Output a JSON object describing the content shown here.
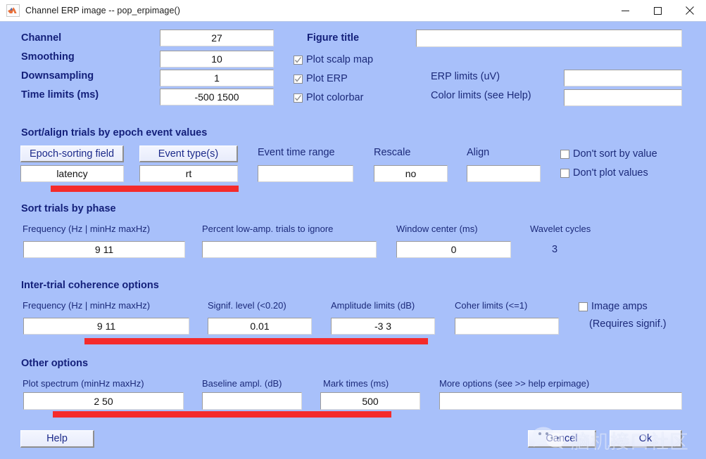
{
  "window": {
    "title": "Channel ERP image -- pop_erpimage()",
    "icon": "matlab-icon",
    "controls": {
      "minimize": "minimize-icon",
      "maximize": "maximize-icon",
      "close": "close-icon"
    }
  },
  "colors": {
    "background": "#a8c0fa",
    "label_text": "#1c2a7a",
    "field_background": "#ffffff",
    "highlight_bar": "#f42b2b"
  },
  "top_section": {
    "labels": {
      "channel": "Channel",
      "smoothing": "Smoothing",
      "downsampling": "Downsampling",
      "time_limits": "Time limits (ms)",
      "figure_title": "Figure title",
      "erp_limits": "ERP limits (uV)",
      "color_limits": "Color limits (see Help)"
    },
    "values": {
      "channel": "27",
      "smoothing": "10",
      "downsampling": "1",
      "time_limits": "-500 1500",
      "figure_title": "",
      "erp_limits": "",
      "color_limits": ""
    },
    "checkboxes": [
      {
        "label": "Plot scalp map",
        "checked": true
      },
      {
        "label": "Plot ERP",
        "checked": true
      },
      {
        "label": "Plot colorbar",
        "checked": true
      }
    ]
  },
  "sort_align_section": {
    "heading": "Sort/align trials by epoch event values",
    "buttons": {
      "epoch_sorting_field": "Epoch-sorting field",
      "event_types": "Event type(s)"
    },
    "labels": {
      "event_time_range": "Event time range",
      "rescale": "Rescale",
      "align": "Align"
    },
    "values": {
      "epoch_sorting_field": "latency",
      "event_types": "rt",
      "event_time_range": "",
      "rescale": "no",
      "align": ""
    },
    "checkboxes": [
      {
        "label": "Don't sort by value",
        "checked": false
      },
      {
        "label": "Don't plot values",
        "checked": false
      }
    ]
  },
  "sort_phase_section": {
    "heading": "Sort trials by phase",
    "labels": {
      "frequency": "Frequency (Hz | minHz maxHz)",
      "percent_low_amp": "Percent low-amp. trials to ignore",
      "window_center": "Window center (ms)",
      "wavelet_cycles": "Wavelet cycles"
    },
    "values": {
      "frequency": "9 11",
      "percent_low_amp": "",
      "window_center": "0",
      "wavelet_cycles": "3"
    }
  },
  "coherence_section": {
    "heading": "Inter-trial coherence options",
    "labels": {
      "frequency": "Frequency (Hz | minHz maxHz)",
      "signif_level": "Signif. level (<0.20)",
      "amplitude_limits": "Amplitude limits (dB)",
      "coher_limits": "Coher limits (<=1)"
    },
    "values": {
      "frequency": "9 11",
      "signif_level": "0.01",
      "amplitude_limits": "-3 3",
      "coher_limits": ""
    },
    "checkbox": {
      "label": "Image amps",
      "checked": false
    },
    "note": "(Requires signif.)"
  },
  "other_section": {
    "heading": "Other options",
    "labels": {
      "plot_spectrum": "Plot spectrum (minHz maxHz)",
      "baseline_ampl": "Baseline ampl. (dB)",
      "mark_times": "Mark times (ms)",
      "more_options": "More options (see >> help erpimage)"
    },
    "values": {
      "plot_spectrum": "2 50",
      "baseline_ampl": "",
      "mark_times": "500",
      "more_options": ""
    }
  },
  "footer": {
    "help": "Help",
    "cancel": "Cancel",
    "ok": "Ok"
  },
  "watermark": {
    "text": "脑机接口社区",
    "icon": "wechat-icon"
  }
}
